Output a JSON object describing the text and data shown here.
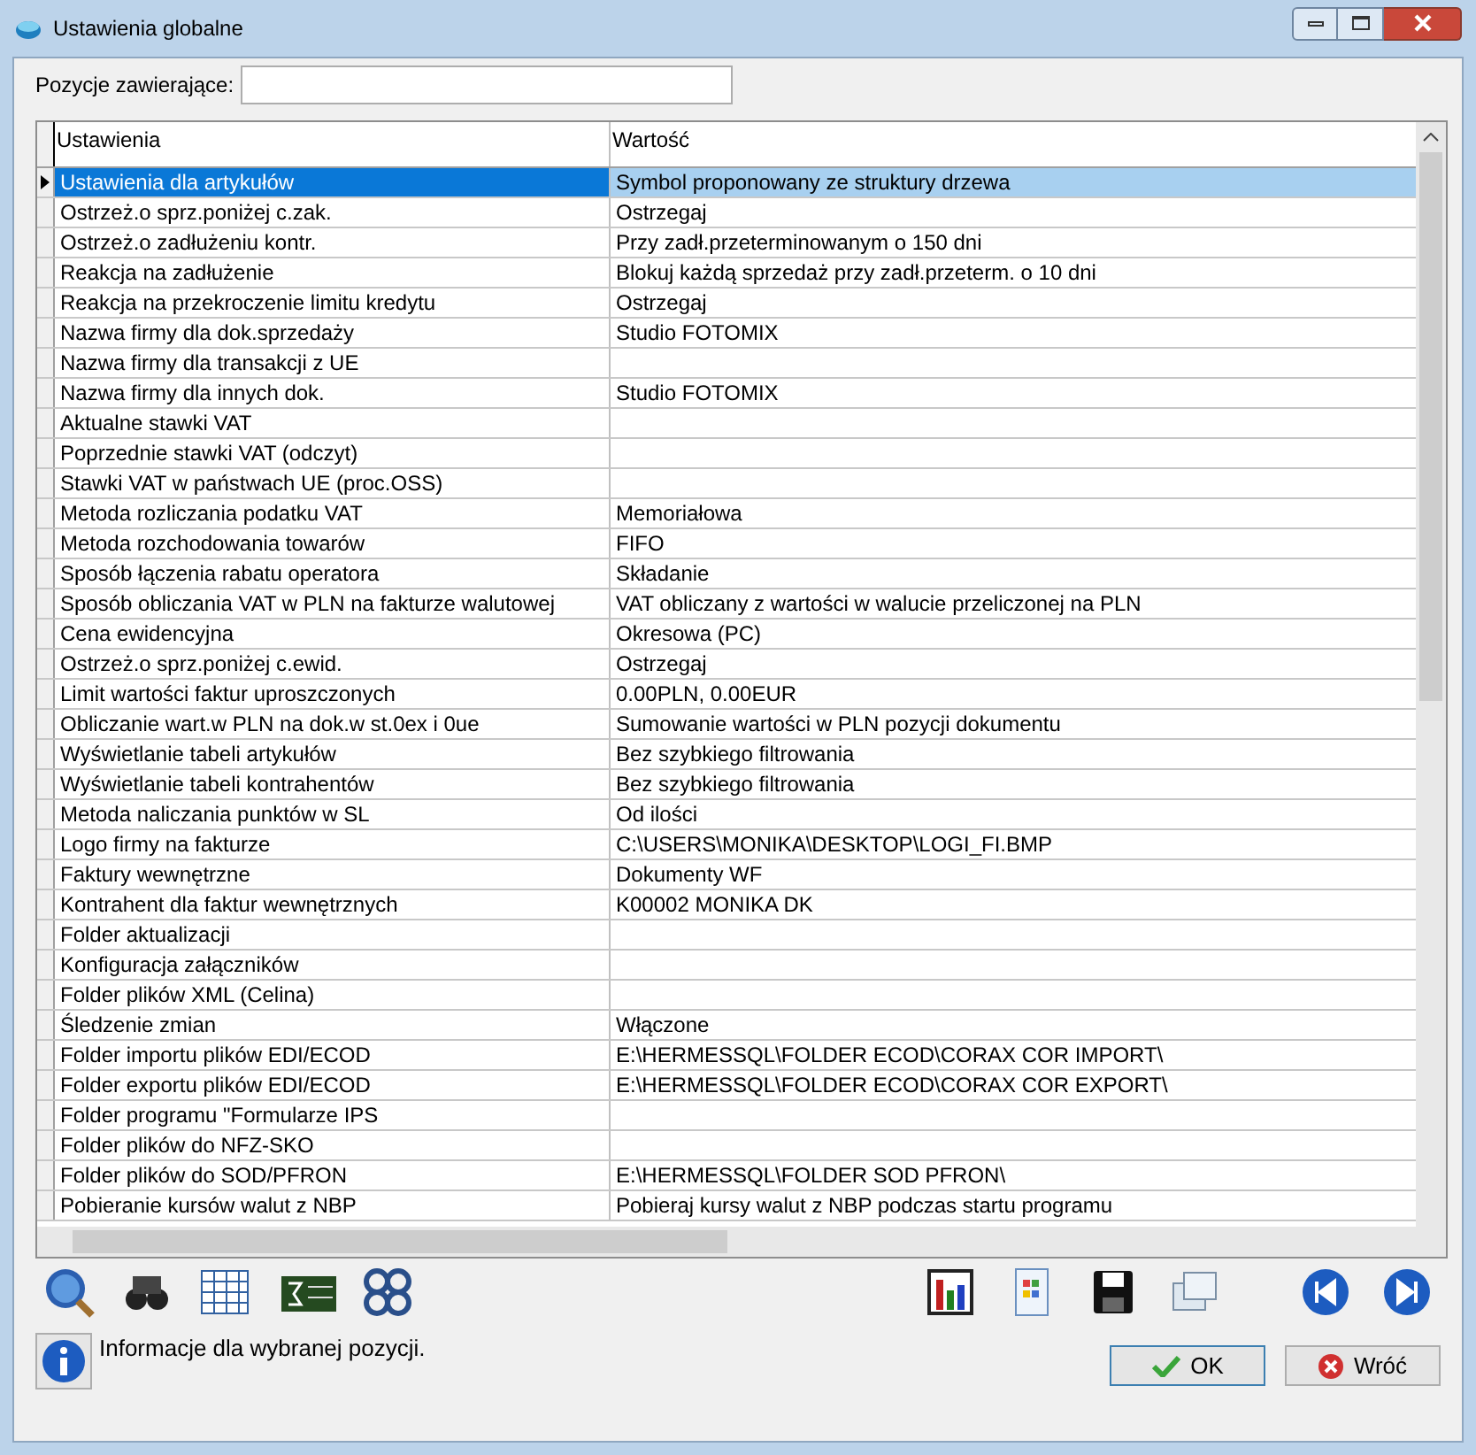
{
  "window": {
    "title": "Ustawienia globalne"
  },
  "filter": {
    "label": "Pozycje zawierające:"
  },
  "table": {
    "columns": [
      "Ustawienia",
      "Wartość"
    ],
    "rows": [
      {
        "name": "Ustawienia dla artykułów",
        "value": "Symbol proponowany ze struktury drzewa",
        "selected": true
      },
      {
        "name": "Ostrzeż.o sprz.poniżej c.zak.",
        "value": "Ostrzegaj",
        "selected": false
      },
      {
        "name": "Ostrzeż.o zadłużeniu kontr.",
        "value": "Przy zadł.przeterminowanym o 150 dni",
        "selected": false
      },
      {
        "name": "Reakcja na zadłużenie",
        "value": "Blokuj każdą sprzedaż przy zadł.przeterm. o 10 dni",
        "selected": false
      },
      {
        "name": "Reakcja na przekroczenie limitu kredytu",
        "value": "Ostrzegaj",
        "selected": false
      },
      {
        "name": "Nazwa firmy dla dok.sprzedaży",
        "value": "Studio FOTOMIX",
        "selected": false
      },
      {
        "name": "Nazwa firmy dla transakcji z UE",
        "selected": false
      },
      {
        "name": "Nazwa firmy dla innych dok.",
        "value": "Studio FOTOMIX",
        "selected": false
      },
      {
        "name": "Aktualne stawki VAT",
        "selected": false
      },
      {
        "name": "Poprzednie stawki VAT (odczyt)",
        "selected": false
      },
      {
        "name": "Stawki VAT w państwach UE (proc.OSS)",
        "selected": false
      },
      {
        "name": "Metoda rozliczania podatku VAT",
        "value": "Memoriałowa",
        "selected": false
      },
      {
        "name": "Metoda rozchodowania towarów",
        "value": "FIFO",
        "selected": false
      },
      {
        "name": "Sposób łączenia rabatu operatora",
        "value": "Składanie",
        "selected": false
      },
      {
        "name": "Sposób obliczania VAT w PLN na fakturze walutowej",
        "value": "VAT obliczany z wartości w walucie przeliczonej na PLN",
        "selected": false
      },
      {
        "name": "Cena ewidencyjna",
        "value": "Okresowa (PC)",
        "selected": false
      },
      {
        "name": "Ostrzeż.o sprz.poniżej c.ewid.",
        "value": "Ostrzegaj",
        "selected": false
      },
      {
        "name": "Limit wartości faktur uproszczonych",
        "value": "0.00PLN, 0.00EUR",
        "selected": false
      },
      {
        "name": "Obliczanie wart.w PLN na dok.w st.0ex i 0ue",
        "value": "Sumowanie wartości w PLN pozycji dokumentu",
        "selected": false
      },
      {
        "name": "Wyświetlanie tabeli artykułów",
        "value": "Bez szybkiego filtrowania",
        "selected": false
      },
      {
        "name": "Wyświetlanie tabeli kontrahentów",
        "value": "Bez szybkiego filtrowania",
        "selected": false
      },
      {
        "name": "Metoda naliczania punktów w SL",
        "value": "Od ilości",
        "selected": false
      },
      {
        "name": "Logo firmy na fakturze",
        "value": "C:\\USERS\\MONIKA\\DESKTOP\\LOGI_FI.BMP",
        "selected": false
      },
      {
        "name": "Faktury wewnętrzne",
        "value": "Dokumenty WF",
        "selected": false
      },
      {
        "name": "Kontrahent dla faktur wewnętrznych",
        "value": "K00002 MONIKA DK",
        "selected": false
      },
      {
        "name": "Folder aktualizacji",
        "selected": false
      },
      {
        "name": "Konfiguracja załączników",
        "selected": false
      },
      {
        "name": "Folder plików XML (Celina)",
        "selected": false
      },
      {
        "name": "Śledzenie zmian",
        "value": "Włączone",
        "selected": false
      },
      {
        "name": "Folder importu plików EDI/ECOD",
        "value": "E:\\HERMESSQL\\FOLDER ECOD\\CORAX COR IMPORT\\",
        "selected": false
      },
      {
        "name": "Folder exportu plików EDI/ECOD",
        "value": "E:\\HERMESSQL\\FOLDER ECOD\\CORAX COR EXPORT\\",
        "selected": false
      },
      {
        "name": "Folder programu \"Formularze IPS",
        "selected": false
      },
      {
        "name": "Folder plików do NFZ-SKO",
        "selected": false
      },
      {
        "name": "Folder plików do SOD/PFRON",
        "value": "E:\\HERMESSQL\\FOLDER SOD PFRON\\",
        "selected": false
      },
      {
        "name": "Pobieranie kursów walut z NBP",
        "value": "Pobieraj kursy walut z NBP podczas startu programu",
        "selected": false
      }
    ]
  },
  "info": {
    "text": "Informacje dla wybranej pozycji."
  },
  "buttons": [
    {
      "label": "OK",
      "kind": "ok"
    },
    {
      "label": "Wróć",
      "kind": "cancel"
    }
  ]
}
